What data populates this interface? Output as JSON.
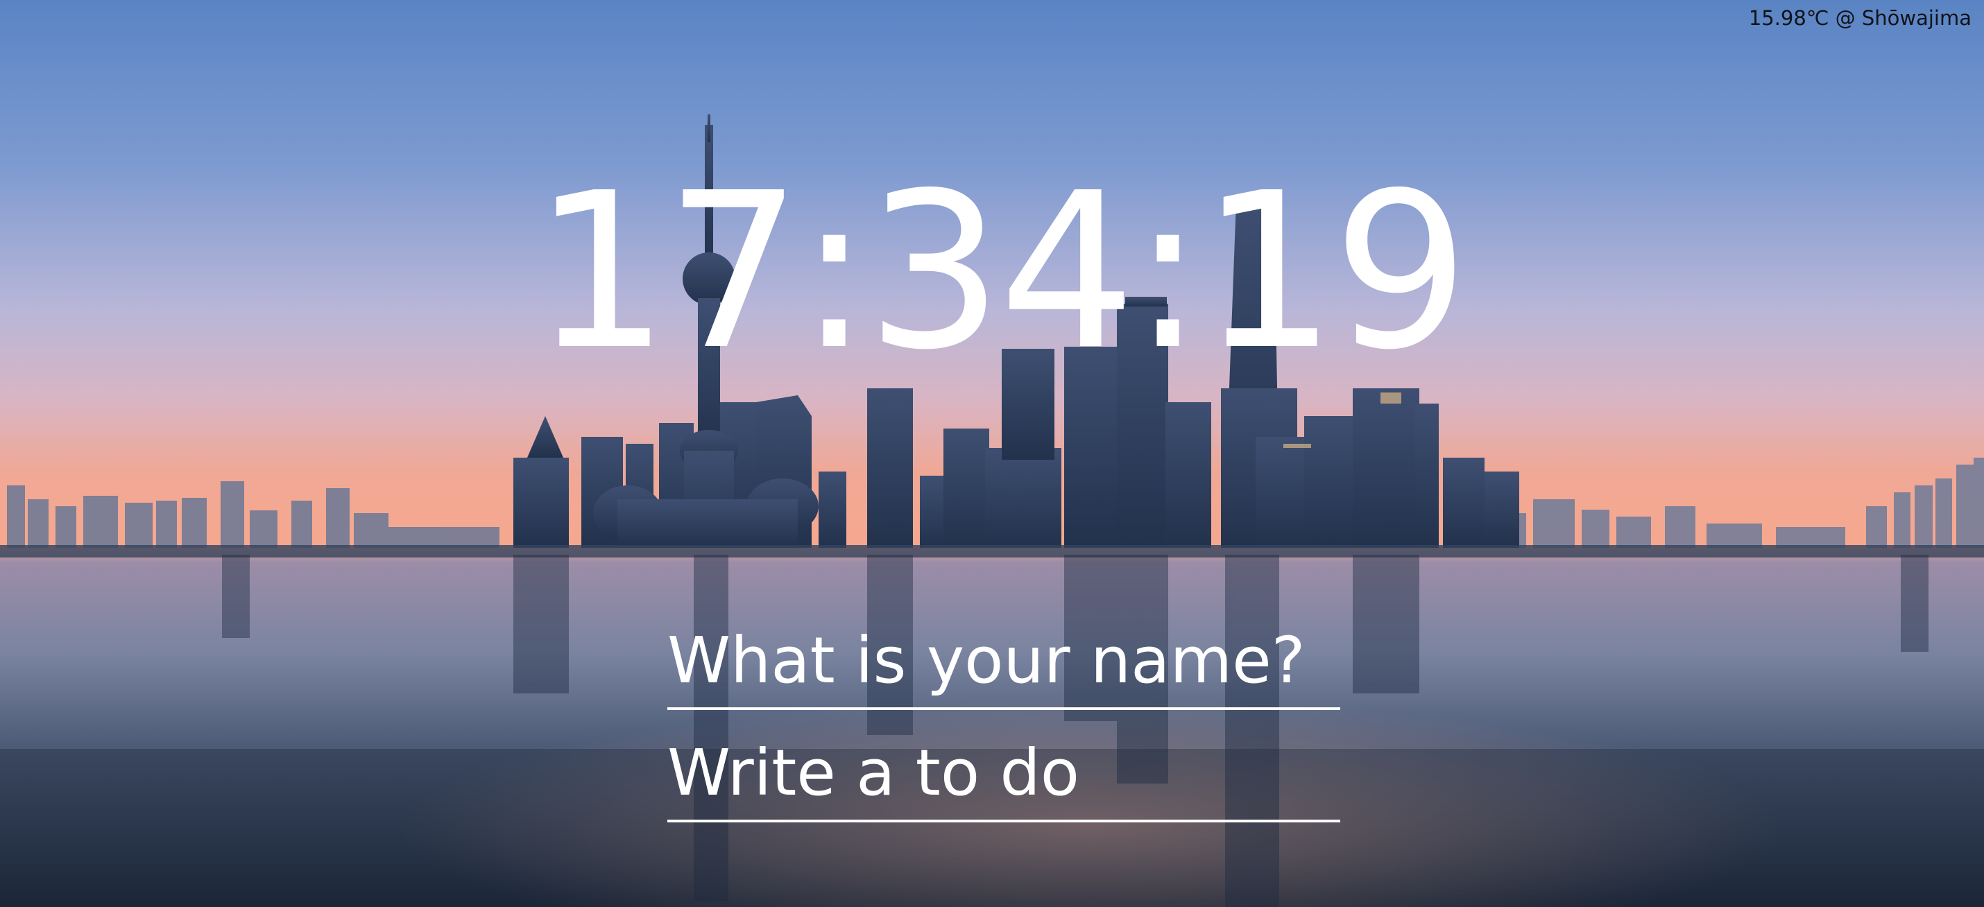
{
  "weather": {
    "label": "15.98℃ @ Shōwajima"
  },
  "clock": {
    "time": "17:34:19"
  },
  "greeting_form": {
    "name_placeholder": "What is your name?"
  },
  "todo_form": {
    "todo_placeholder": "Write a to do"
  },
  "colors": {
    "sky_top": "#5c86c4",
    "sky_mid": "#b9b4d6",
    "horizon": "#f3a58e",
    "water": "#2a3a52",
    "text": "#ffffff"
  },
  "background": {
    "icon": "city-skyline-image"
  }
}
